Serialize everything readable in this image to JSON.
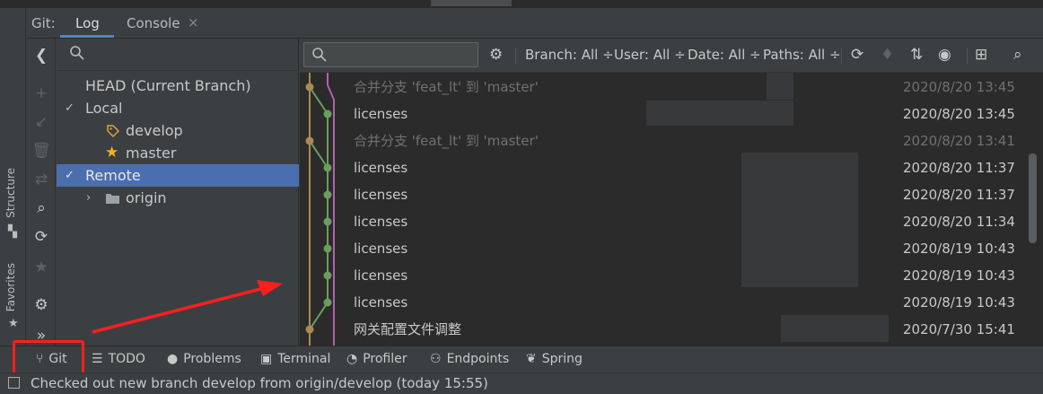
{
  "tabs": {
    "prefix": "Git:",
    "items": [
      {
        "label": "Log",
        "active": true
      },
      {
        "label": "Console",
        "active": false
      }
    ],
    "close_glyph": "×"
  },
  "left_strip": {
    "structure": "Structure",
    "favorites": "Favorites"
  },
  "actions": [
    {
      "icon": "collapse-left-icon",
      "glyph": "❮",
      "enabled": true
    },
    {
      "icon": "add-icon",
      "glyph": "+",
      "enabled": false
    },
    {
      "icon": "update-arrow-icon",
      "glyph": "↙",
      "enabled": false
    },
    {
      "icon": "delete-icon",
      "glyph": "🗑",
      "enabled": false
    },
    {
      "icon": "compare-icon",
      "glyph": "⇄",
      "enabled": false
    },
    {
      "icon": "search-icon",
      "glyph": "⌕",
      "enabled": true
    },
    {
      "icon": "refresh-icon",
      "glyph": "⟳",
      "enabled": true
    },
    {
      "icon": "star-icon",
      "glyph": "★",
      "enabled": false
    },
    {
      "icon": "gear-icon",
      "glyph": "⚙",
      "enabled": true
    },
    {
      "icon": "expand-more-icon",
      "glyph": "»",
      "enabled": true
    }
  ],
  "branches": {
    "head": "HEAD (Current Branch)",
    "local": "Local",
    "local_items": [
      {
        "label": "develop",
        "icon": "tag-icon",
        "glyph": "◇",
        "color": "#d9a343"
      },
      {
        "label": "master",
        "icon": "star-icon",
        "glyph": "★",
        "color": "#f2b41b"
      }
    ],
    "remote": "Remote",
    "remote_items": [
      {
        "label": "origin",
        "icon": "folder-icon"
      }
    ]
  },
  "log_toolbar": {
    "search_placeholder": "",
    "filters": [
      {
        "label": "Branch: All ÷"
      },
      {
        "label": "User: All ÷"
      },
      {
        "label": "Date: All ÷"
      },
      {
        "label": "Paths: All ÷"
      }
    ]
  },
  "commits": [
    {
      "message": "合并分支 'feat_lt' 到 'master'",
      "date": "2020/8/20 13:45",
      "merge": true
    },
    {
      "message": "licenses",
      "date": "2020/8/20 13:45",
      "merge": false
    },
    {
      "message": "合并分支 'feat_lt' 到 'master'",
      "date": "2020/8/20 13:41",
      "merge": true
    },
    {
      "message": "licenses",
      "date": "2020/8/20 11:37",
      "merge": false
    },
    {
      "message": "licenses",
      "date": "2020/8/20 11:37",
      "merge": false
    },
    {
      "message": "licenses",
      "date": "2020/8/20 11:34",
      "merge": false
    },
    {
      "message": "licenses",
      "date": "2020/8/19 10:43",
      "merge": false
    },
    {
      "message": "licenses",
      "date": "2020/8/19 10:43",
      "merge": false
    },
    {
      "message": "licenses",
      "date": "2020/8/19 10:43",
      "merge": false
    },
    {
      "message": "网关配置文件调整",
      "date": "2020/7/30 15:41",
      "merge": false
    }
  ],
  "bottom_tabs": [
    {
      "label": "Git",
      "icon": "git-branch-icon",
      "glyph": "⑂"
    },
    {
      "label": "TODO",
      "icon": "list-icon",
      "glyph": "☰"
    },
    {
      "label": "Problems",
      "icon": "info-icon",
      "glyph": "●"
    },
    {
      "label": "Terminal",
      "icon": "terminal-icon",
      "glyph": "▣"
    },
    {
      "label": "Profiler",
      "icon": "profiler-icon",
      "glyph": "◔"
    },
    {
      "label": "Endpoints",
      "icon": "endpoints-icon",
      "glyph": "⚇"
    },
    {
      "label": "Spring",
      "icon": "spring-leaf-icon",
      "glyph": "❦"
    }
  ],
  "status": {
    "text": "Checked out new branch develop from origin/develop (today 15:55)"
  },
  "colors": {
    "accent": "#4b6eaf",
    "graph_green": "#6a9e5d",
    "graph_gold": "#a88a55",
    "graph_pink": "#b45fb0",
    "annotation_red": "#ff1e1e"
  }
}
